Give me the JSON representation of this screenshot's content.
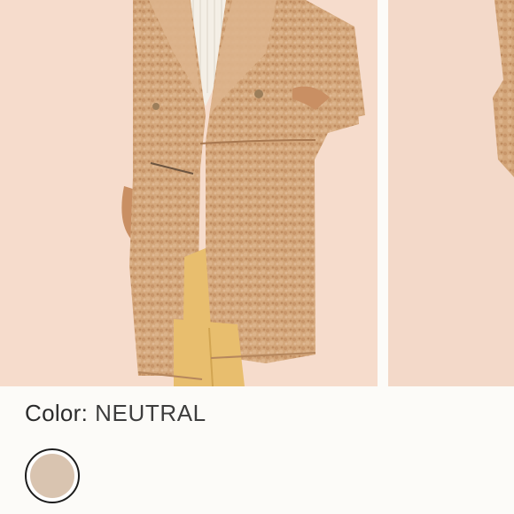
{
  "product": {
    "color_label": "Color:",
    "color_value": "NEUTRAL",
    "swatch": {
      "name": "neutral-swatch",
      "color": "#d9c4b0"
    },
    "photo_colors": {
      "background": "#f6dccc",
      "coat": "#d2a478",
      "pants": "#e8be6e",
      "top": "#f4efe6",
      "skin": "#c98f63"
    }
  }
}
